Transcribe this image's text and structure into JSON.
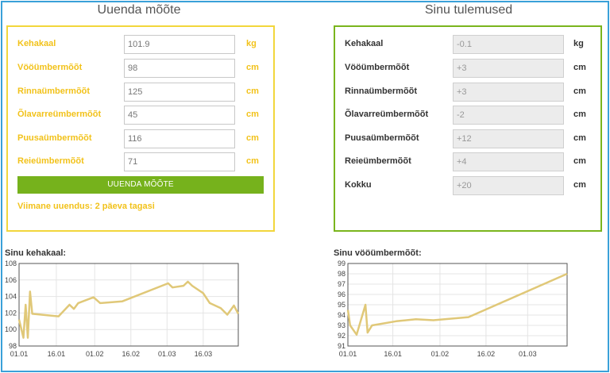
{
  "left_panel": {
    "title": "Uuenda mõõte",
    "rows": [
      {
        "label": "Kehakaal",
        "value": "101.9",
        "unit": "kg"
      },
      {
        "label": "Vööümbermõõt",
        "value": "98",
        "unit": "cm"
      },
      {
        "label": "Rinnaümbermõõt",
        "value": "125",
        "unit": "cm"
      },
      {
        "label": "Õlavarreümbermõõt",
        "value": "45",
        "unit": "cm"
      },
      {
        "label": "Puusaümbermõõt",
        "value": "116",
        "unit": "cm"
      },
      {
        "label": "Reieümbermõõt",
        "value": "71",
        "unit": "cm"
      }
    ],
    "button_label": "UUENDA MÕÕTE",
    "last_update": "Viimane uuendus: 2 päeva tagasi"
  },
  "right_panel": {
    "title": "Sinu tulemused",
    "rows": [
      {
        "label": "Kehakaal",
        "value": "-0.1",
        "unit": "kg"
      },
      {
        "label": "Vööümbermõõt",
        "value": "+3",
        "unit": "cm"
      },
      {
        "label": "Rinnaümbermõõt",
        "value": "+3",
        "unit": "cm"
      },
      {
        "label": "Õlavarreümbermõõt",
        "value": "-2",
        "unit": "cm"
      },
      {
        "label": "Puusaümbermõõt",
        "value": "+12",
        "unit": "cm"
      },
      {
        "label": "Reieümbermõõt",
        "value": "+4",
        "unit": "cm"
      },
      {
        "label": "Kokku",
        "value": "+20",
        "unit": "cm"
      }
    ]
  },
  "colors": {
    "accent_yellow": "#f2d63c",
    "accent_green": "#7ab51d",
    "line": "#e0c878",
    "frame": "#3aa0d8"
  },
  "chart_data": [
    {
      "type": "line",
      "title": "Sinu kehakaal:",
      "xlabel": "",
      "ylabel": "",
      "xlim": [
        0,
        100
      ],
      "ylim": [
        98,
        108
      ],
      "yticks": [
        "98",
        "100",
        "102",
        "104",
        "106",
        "108"
      ],
      "xticks": [
        {
          "label": "01.01",
          "x": 0
        },
        {
          "label": "16.01",
          "x": 17
        },
        {
          "label": "01.02",
          "x": 34.5
        },
        {
          "label": "16.02",
          "x": 51
        },
        {
          "label": "01.03",
          "x": 67.5
        },
        {
          "label": "16.03",
          "x": 84
        }
      ],
      "grid": true,
      "series": [
        {
          "x": [
            0,
            2,
            3,
            4,
            5,
            6,
            18,
            23,
            25,
            27,
            34,
            37,
            47,
            68,
            70,
            75,
            77,
            79,
            84,
            87,
            92,
            95,
            98,
            100
          ],
          "y": [
            101.2,
            99.0,
            103.0,
            99.0,
            104.6,
            101.9,
            101.6,
            103.0,
            102.5,
            103.2,
            103.9,
            103.2,
            103.4,
            105.6,
            105.1,
            105.3,
            105.8,
            105.3,
            104.4,
            103.2,
            102.6,
            101.8,
            102.9,
            101.9
          ]
        }
      ]
    },
    {
      "type": "line",
      "title": "Sinu vööümbermõõt:",
      "xlabel": "",
      "ylabel": "",
      "xlim": [
        0,
        100
      ],
      "ylim": [
        91,
        99
      ],
      "yticks": [
        "91",
        "92",
        "93",
        "94",
        "95",
        "96",
        "97",
        "98",
        "99"
      ],
      "xticks": [
        {
          "label": "01.01",
          "x": 0
        },
        {
          "label": "16.01",
          "x": 20.5
        },
        {
          "label": "01.02",
          "x": 42
        },
        {
          "label": "16.02",
          "x": 63
        },
        {
          "label": "01.03",
          "x": 82
        }
      ],
      "grid": true,
      "series": [
        {
          "x": [
            0,
            1,
            4,
            8,
            9,
            11,
            22,
            31,
            39,
            55,
            100
          ],
          "y": [
            94.5,
            93.0,
            92.1,
            95.0,
            92.3,
            93.0,
            93.4,
            93.6,
            93.5,
            93.8,
            98.0
          ]
        }
      ]
    }
  ]
}
